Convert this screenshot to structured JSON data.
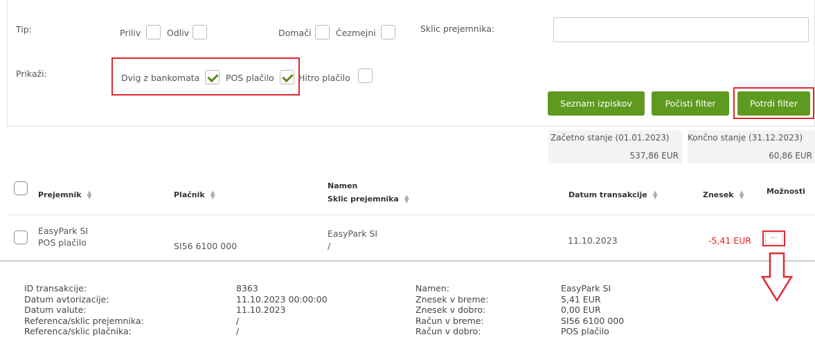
{
  "filters": {
    "tip_label": "Tip:",
    "priliv": "Priliv",
    "odliv": "Odliv",
    "domaci": "Domači",
    "cezmejni": "Čezmejni",
    "sklic_label": "Sklic prejemnika:",
    "sklic_value": "",
    "prikazi_label": "Prikaži:",
    "dvig": "Dvig z bankomata",
    "pos": "POS plačilo",
    "hitro": "Hitro plačilo"
  },
  "buttons": {
    "seznam": "Seznam izpiskov",
    "pocisti": "Počisti filter",
    "potrdi": "Potrdi filter"
  },
  "balances": {
    "start_label": "Začetno stanje (01.01.2023)",
    "start_value": "537,86 EUR",
    "end_label": "Končno stanje (31.12.2023)",
    "end_value": "60,86 EUR"
  },
  "table": {
    "headers": {
      "prejemnik": "Prejemnik",
      "placnik": "Plačnik",
      "namen": "Namen",
      "sklic": "Sklic prejemnika",
      "datum": "Datum transakcije",
      "znesek": "Znesek",
      "moznosti": "Možnosti"
    },
    "row": {
      "prejemnik": "EasyPark SI",
      "tip": "POS plačilo",
      "placnik": "SI56 6100 000",
      "namen": "EasyPark SI",
      "sklic": "/",
      "datum": "11.10.2023",
      "znesek": "-5,41 EUR",
      "moznosti": "···"
    }
  },
  "details": {
    "left_labels": [
      "ID transakcije:",
      "Datum avtorizacije:",
      "Datum valute:",
      "Referenca/sklic prejemnika:",
      "Referenca/sklic plačnika:"
    ],
    "left_values": [
      "8363",
      "11.10.2023 00:00:00",
      "11.10.2023",
      "/",
      "/"
    ],
    "right_labels": [
      "Namen:",
      "Znesek v breme:",
      "Znesek v dobro:",
      "Račun v breme:",
      "Račun v dobro:"
    ],
    "right_values": [
      "EasyPark SI",
      "5,41 EUR",
      "0,00 EUR",
      "SI56 6100 000",
      "POS plačilo"
    ]
  },
  "colors": {
    "accent_green": "#5e9a1f",
    "highlight_red": "#e2262f",
    "negative_amount": "#e02020"
  },
  "icons": [
    "check-icon",
    "sort-icon",
    "more-options-icon",
    "arrow-down-icon"
  ]
}
